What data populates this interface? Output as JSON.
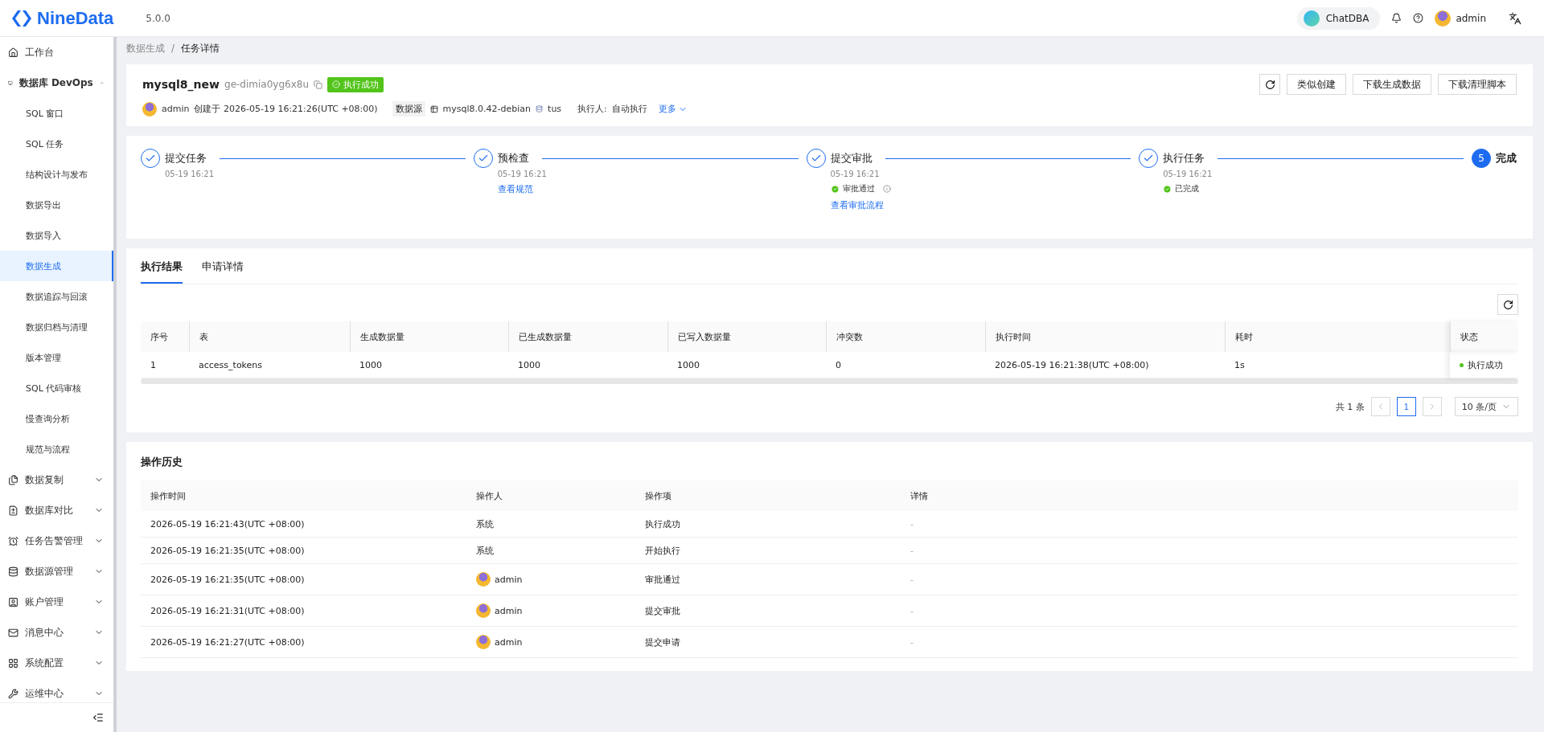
{
  "header": {
    "logo_text": "NineData",
    "version": "5.0.0",
    "chat_button": "ChatDBA",
    "user": "admin"
  },
  "sidebar": {
    "items": [
      {
        "kind": "link",
        "label": "工作台",
        "selected": false
      },
      {
        "kind": "group",
        "label": "数据库 DevOps",
        "expanded": true,
        "children": [
          {
            "label": "SQL 窗口",
            "selected": false
          },
          {
            "label": "SQL 任务",
            "selected": false
          },
          {
            "label": "结构设计与发布",
            "selected": false
          },
          {
            "label": "数据导出",
            "selected": false
          },
          {
            "label": "数据导入",
            "selected": false
          },
          {
            "label": "数据生成",
            "selected": true
          },
          {
            "label": "数据追踪与回滚",
            "selected": false
          },
          {
            "label": "数据归档与清理",
            "selected": false
          },
          {
            "label": "版本管理",
            "selected": false
          },
          {
            "label": "SQL 代码审核",
            "selected": false
          },
          {
            "label": "慢查询分析",
            "selected": false
          },
          {
            "label": "规范与流程",
            "selected": false
          }
        ]
      },
      {
        "kind": "group",
        "label": "数据复制",
        "expanded": false
      },
      {
        "kind": "group",
        "label": "数据库对比",
        "expanded": false
      },
      {
        "kind": "group",
        "label": "任务告警管理",
        "expanded": false
      },
      {
        "kind": "group",
        "label": "数据源管理",
        "expanded": false
      },
      {
        "kind": "group",
        "label": "账户管理",
        "expanded": false
      },
      {
        "kind": "group",
        "label": "消息中心",
        "expanded": false
      },
      {
        "kind": "group",
        "label": "系统配置",
        "expanded": false
      },
      {
        "kind": "group",
        "label": "运维中心",
        "expanded": false
      }
    ]
  },
  "breadcrumb": {
    "separator": "/",
    "items": [
      "数据生成",
      "任务详情"
    ]
  },
  "task": {
    "name": "mysql8_new",
    "id": "ge-dimia0yg6x8u",
    "status": "执行成功",
    "creator": "admin",
    "created": "创建于 2026-05-19 16:21:26(UTC +08:00)",
    "datasource_label": "数据源",
    "datasource": "mysql8.0.42-debian",
    "database": "tus",
    "executor_label": "执行人:",
    "executor": "自动执行",
    "more": "更多",
    "buttons": [
      "类似创建",
      "下载生成数据",
      "下载清理脚本"
    ]
  },
  "steps": [
    {
      "done": true,
      "title": "提交任务",
      "time": "05-19 16:21"
    },
    {
      "done": true,
      "title": "预检查",
      "time": "05-19 16:21",
      "notes": [
        {
          "kind": "link",
          "text": "查看规范"
        }
      ]
    },
    {
      "done": true,
      "title": "提交审批",
      "time": "05-19 16:21",
      "notes": [
        {
          "kind": "status",
          "text": "审批通过",
          "info": true
        },
        {
          "kind": "link",
          "text": "查看审批流程"
        }
      ]
    },
    {
      "done": true,
      "title": "执行任务",
      "time": "05-19 16:21",
      "notes": [
        {
          "kind": "status",
          "text": "已完成",
          "info": false
        }
      ]
    },
    {
      "done": false,
      "number": "5",
      "title": "完成"
    }
  ],
  "result_tabs": [
    {
      "label": "执行结果",
      "selected": true
    },
    {
      "label": "申请详情",
      "selected": false
    }
  ],
  "results": {
    "columns": [
      "序号",
      "表",
      "生成数据量",
      "已生成数据量",
      "已写入数据量",
      "冲突数",
      "执行时间",
      "耗时",
      "状态"
    ],
    "rows": [
      {
        "cells": [
          "1",
          "access_tokens",
          "1000",
          "1000",
          "1000",
          "0",
          "2026-05-19 16:21:38(UTC +08:00)",
          "1s"
        ],
        "status": "执行成功",
        "color": "#52c41a"
      }
    ]
  },
  "pagination": {
    "total": "共 1 条",
    "pages": [
      {
        "label": "1",
        "selected": true
      }
    ],
    "page_size": "10 条/页"
  },
  "history": {
    "title": "操作历史",
    "columns": [
      "操作时间",
      "操作人",
      "操作项",
      "详情"
    ],
    "rows": [
      {
        "time": "2026-05-19 16:21:43(UTC +08:00)",
        "operator": "系统",
        "avatar": false,
        "action": "执行成功",
        "details": "-"
      },
      {
        "time": "2026-05-19 16:21:35(UTC +08:00)",
        "operator": "系统",
        "avatar": false,
        "action": "开始执行",
        "details": "-"
      },
      {
        "time": "2026-05-19 16:21:35(UTC +08:00)",
        "operator": "admin",
        "avatar": true,
        "action": "审批通过",
        "details": "-"
      },
      {
        "time": "2026-05-19 16:21:31(UTC +08:00)",
        "operator": "admin",
        "avatar": true,
        "action": "提交审批",
        "details": "-"
      },
      {
        "time": "2026-05-19 16:21:27(UTC +08:00)",
        "operator": "admin",
        "avatar": true,
        "action": "提交申请",
        "details": "-"
      }
    ]
  }
}
